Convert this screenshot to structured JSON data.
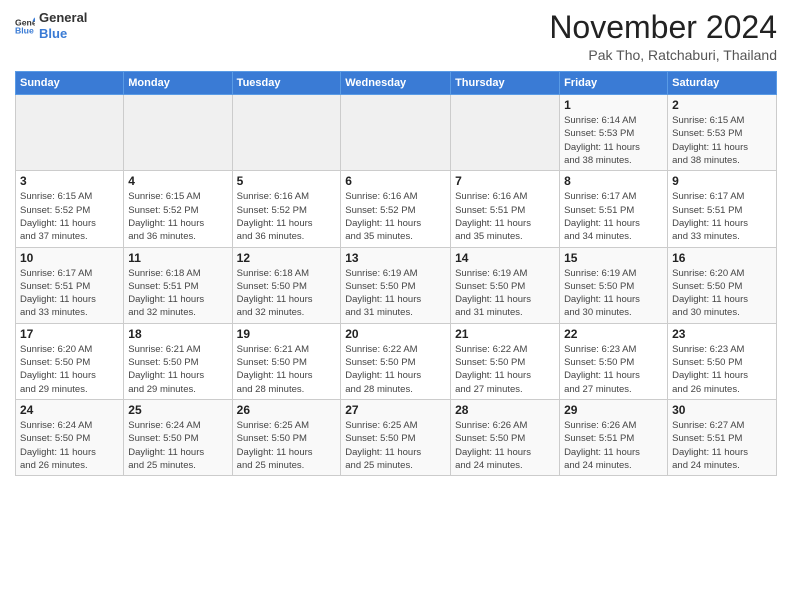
{
  "header": {
    "logo_general": "General",
    "logo_blue": "Blue",
    "main_title": "November 2024",
    "sub_title": "Pak Tho, Ratchaburi, Thailand"
  },
  "calendar": {
    "weekdays": [
      "Sunday",
      "Monday",
      "Tuesday",
      "Wednesday",
      "Thursday",
      "Friday",
      "Saturday"
    ],
    "weeks": [
      [
        {
          "day": "",
          "info": ""
        },
        {
          "day": "",
          "info": ""
        },
        {
          "day": "",
          "info": ""
        },
        {
          "day": "",
          "info": ""
        },
        {
          "day": "",
          "info": ""
        },
        {
          "day": "1",
          "info": "Sunrise: 6:14 AM\nSunset: 5:53 PM\nDaylight: 11 hours\nand 38 minutes."
        },
        {
          "day": "2",
          "info": "Sunrise: 6:15 AM\nSunset: 5:53 PM\nDaylight: 11 hours\nand 38 minutes."
        }
      ],
      [
        {
          "day": "3",
          "info": "Sunrise: 6:15 AM\nSunset: 5:52 PM\nDaylight: 11 hours\nand 37 minutes."
        },
        {
          "day": "4",
          "info": "Sunrise: 6:15 AM\nSunset: 5:52 PM\nDaylight: 11 hours\nand 36 minutes."
        },
        {
          "day": "5",
          "info": "Sunrise: 6:16 AM\nSunset: 5:52 PM\nDaylight: 11 hours\nand 36 minutes."
        },
        {
          "day": "6",
          "info": "Sunrise: 6:16 AM\nSunset: 5:52 PM\nDaylight: 11 hours\nand 35 minutes."
        },
        {
          "day": "7",
          "info": "Sunrise: 6:16 AM\nSunset: 5:51 PM\nDaylight: 11 hours\nand 35 minutes."
        },
        {
          "day": "8",
          "info": "Sunrise: 6:17 AM\nSunset: 5:51 PM\nDaylight: 11 hours\nand 34 minutes."
        },
        {
          "day": "9",
          "info": "Sunrise: 6:17 AM\nSunset: 5:51 PM\nDaylight: 11 hours\nand 33 minutes."
        }
      ],
      [
        {
          "day": "10",
          "info": "Sunrise: 6:17 AM\nSunset: 5:51 PM\nDaylight: 11 hours\nand 33 minutes."
        },
        {
          "day": "11",
          "info": "Sunrise: 6:18 AM\nSunset: 5:51 PM\nDaylight: 11 hours\nand 32 minutes."
        },
        {
          "day": "12",
          "info": "Sunrise: 6:18 AM\nSunset: 5:50 PM\nDaylight: 11 hours\nand 32 minutes."
        },
        {
          "day": "13",
          "info": "Sunrise: 6:19 AM\nSunset: 5:50 PM\nDaylight: 11 hours\nand 31 minutes."
        },
        {
          "day": "14",
          "info": "Sunrise: 6:19 AM\nSunset: 5:50 PM\nDaylight: 11 hours\nand 31 minutes."
        },
        {
          "day": "15",
          "info": "Sunrise: 6:19 AM\nSunset: 5:50 PM\nDaylight: 11 hours\nand 30 minutes."
        },
        {
          "day": "16",
          "info": "Sunrise: 6:20 AM\nSunset: 5:50 PM\nDaylight: 11 hours\nand 30 minutes."
        }
      ],
      [
        {
          "day": "17",
          "info": "Sunrise: 6:20 AM\nSunset: 5:50 PM\nDaylight: 11 hours\nand 29 minutes."
        },
        {
          "day": "18",
          "info": "Sunrise: 6:21 AM\nSunset: 5:50 PM\nDaylight: 11 hours\nand 29 minutes."
        },
        {
          "day": "19",
          "info": "Sunrise: 6:21 AM\nSunset: 5:50 PM\nDaylight: 11 hours\nand 28 minutes."
        },
        {
          "day": "20",
          "info": "Sunrise: 6:22 AM\nSunset: 5:50 PM\nDaylight: 11 hours\nand 28 minutes."
        },
        {
          "day": "21",
          "info": "Sunrise: 6:22 AM\nSunset: 5:50 PM\nDaylight: 11 hours\nand 27 minutes."
        },
        {
          "day": "22",
          "info": "Sunrise: 6:23 AM\nSunset: 5:50 PM\nDaylight: 11 hours\nand 27 minutes."
        },
        {
          "day": "23",
          "info": "Sunrise: 6:23 AM\nSunset: 5:50 PM\nDaylight: 11 hours\nand 26 minutes."
        }
      ],
      [
        {
          "day": "24",
          "info": "Sunrise: 6:24 AM\nSunset: 5:50 PM\nDaylight: 11 hours\nand 26 minutes."
        },
        {
          "day": "25",
          "info": "Sunrise: 6:24 AM\nSunset: 5:50 PM\nDaylight: 11 hours\nand 25 minutes."
        },
        {
          "day": "26",
          "info": "Sunrise: 6:25 AM\nSunset: 5:50 PM\nDaylight: 11 hours\nand 25 minutes."
        },
        {
          "day": "27",
          "info": "Sunrise: 6:25 AM\nSunset: 5:50 PM\nDaylight: 11 hours\nand 25 minutes."
        },
        {
          "day": "28",
          "info": "Sunrise: 6:26 AM\nSunset: 5:50 PM\nDaylight: 11 hours\nand 24 minutes."
        },
        {
          "day": "29",
          "info": "Sunrise: 6:26 AM\nSunset: 5:51 PM\nDaylight: 11 hours\nand 24 minutes."
        },
        {
          "day": "30",
          "info": "Sunrise: 6:27 AM\nSunset: 5:51 PM\nDaylight: 11 hours\nand 24 minutes."
        }
      ]
    ]
  }
}
